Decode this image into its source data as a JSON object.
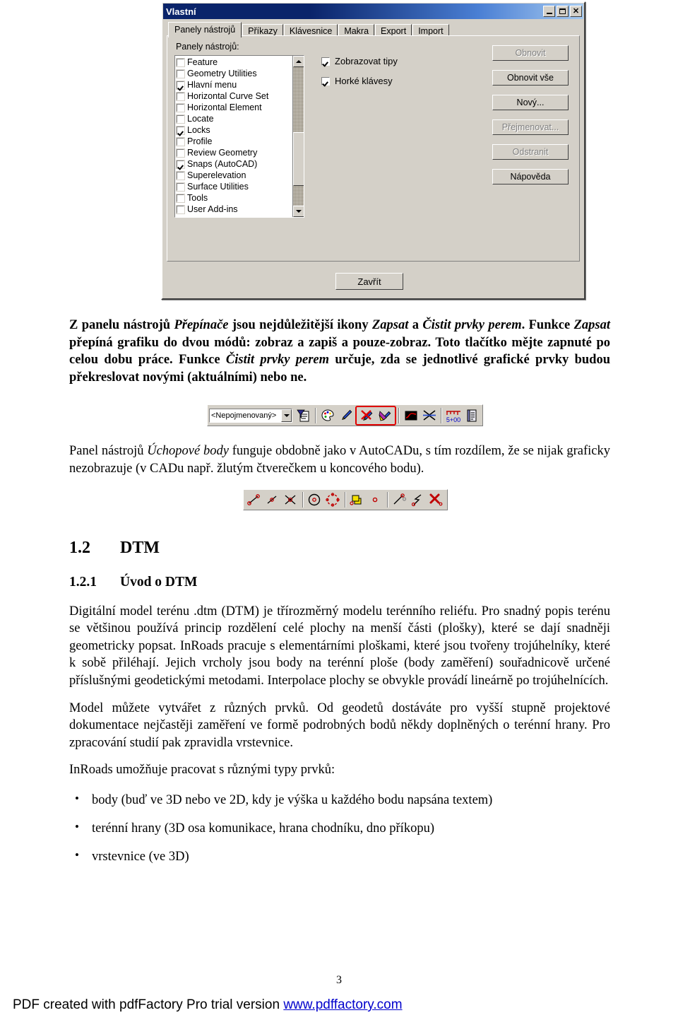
{
  "dialog": {
    "title": "Vlastní",
    "window_buttons": [
      {
        "name": "minimize",
        "glyph": "_"
      },
      {
        "name": "maximize",
        "glyph": "□"
      },
      {
        "name": "close",
        "glyph": "✕"
      }
    ],
    "tabs": [
      {
        "label": "Panely nástrojů",
        "active": true
      },
      {
        "label": "Příkazy",
        "active": false
      },
      {
        "label": "Klávesnice",
        "active": false
      },
      {
        "label": "Makra",
        "active": false
      },
      {
        "label": "Export",
        "active": false
      },
      {
        "label": "Import",
        "active": false
      }
    ],
    "group_label": "Panely nástrojů:",
    "toolbar_list": [
      {
        "label": "Feature",
        "checked": false
      },
      {
        "label": "Geometry Utilities",
        "checked": false
      },
      {
        "label": "Hlavní menu",
        "checked": true
      },
      {
        "label": "Horizontal Curve Set",
        "checked": false
      },
      {
        "label": "Horizontal Element",
        "checked": false
      },
      {
        "label": "Locate",
        "checked": false
      },
      {
        "label": "Locks",
        "checked": true
      },
      {
        "label": "Profile",
        "checked": false
      },
      {
        "label": "Review Geometry",
        "checked": false
      },
      {
        "label": "Snaps (AutoCAD)",
        "checked": true
      },
      {
        "label": "Superelevation",
        "checked": false
      },
      {
        "label": "Surface Utilities",
        "checked": false
      },
      {
        "label": "Tools",
        "checked": false
      },
      {
        "label": "User Add-ins",
        "checked": false
      }
    ],
    "options": [
      {
        "label": "Zobrazovat tipy",
        "checked": true
      },
      {
        "label": "Horké klávesy",
        "checked": true
      }
    ],
    "buttons": [
      {
        "label": "Obnovit",
        "disabled": true
      },
      {
        "label": "Obnovit vše",
        "disabled": false
      },
      {
        "label": "Nový...",
        "disabled": false
      },
      {
        "label": "Přejmenovat...",
        "disabled": true
      },
      {
        "label": "Odstranit",
        "disabled": true
      },
      {
        "label": "Nápověda",
        "disabled": false
      }
    ],
    "close_button": "Zavřít"
  },
  "doc": {
    "p1_a": "Z panelu nástrojů ",
    "p1_i1": "Přepínače",
    "p1_b": " jsou nejdůležitější ikony ",
    "p1_i2": "Zapsat",
    "p1_c": " a ",
    "p1_i3": "Čistit prvky perem",
    "p1_d": ". Funkce ",
    "p1_i4": "Zapsat",
    "p1_e": " přepíná grafiku do dvou módů: zobraz a zapiš a pouze-zobraz. Toto tlačítko mějte zapnuté po celou dobu práce. Funkce ",
    "p1_i5": "Čistit prvky perem",
    "p1_f": " určuje, zda se jednotlivé grafické prvky budou překreslovat novými (aktuálními) nebo ne.",
    "p2_a": "Panel nástrojů ",
    "p2_i1": "Úchopové body",
    "p2_b": " funguje obdobně jako v AutoCADu, s tím rozdílem, že se nijak graficky nezobrazuje (v CADu např. žlutým čtverečkem u koncového bodu).",
    "h2_num": "1.2",
    "h2_text": "DTM",
    "h3_num": "1.2.1",
    "h3_text": "Úvod o DTM",
    "p3": "Digitální model terénu .dtm (DTM) je třírozměrný modelu terénního reliéfu. Pro snadný popis terénu se většinou používá princip rozdělení celé plochy na menší části (plošky), které se dají snadněji geometricky popsat. InRoads pracuje s elementárními ploškami, které jsou tvořeny trojúhelníky, které k sobě přiléhají. Jejich vrcholy jsou body na terénní ploše (body zaměření) souřadnicově určené příslušnými geodetickými metodami. Interpolace plochy se obvykle provádí lineárně po trojúhelnících.",
    "p4": "Model můžete vytvářet z různých prvků. Od geodetů dostáváte pro vyšší stupně projektové dokumentace nejčastěji zaměření ve formě podrobných bodů někdy doplněných o terénní hrany. Pro zpracování studií pak zpravidla vrstevnice.",
    "p5": "InRoads umožňuje pracovat s různými typy prvků:",
    "bullets": [
      "body (buď ve 3D nebo ve 2D, kdy je výška u každého bodu napsána textem)",
      "terénní hrany (3D osa komunikace, hrana chodníku, dno příkopu)",
      "vrstevnice (ve 3D)"
    ]
  },
  "toolbar1": {
    "combo_value": "<Nepojmenovaný>",
    "icons": [
      {
        "name": "named-view-icon"
      },
      {
        "name": "color-palette-icon"
      },
      {
        "name": "pen-icon"
      },
      {
        "name": "clear-pen-icon"
      },
      {
        "name": "write-pen-icon"
      },
      {
        "name": "display-curve-icon"
      },
      {
        "name": "cross-lines-icon"
      },
      {
        "name": "station-ruler-icon"
      },
      {
        "name": "report-icon"
      }
    ],
    "highlight_color": "#e00000",
    "station_label": "5+00"
  },
  "toolbar2": {
    "icons": [
      {
        "name": "snap-endpoint-icon"
      },
      {
        "name": "snap-midpoint-icon"
      },
      {
        "name": "snap-intersection-icon"
      },
      {
        "name": "snap-center-icon"
      },
      {
        "name": "snap-quadrant-icon"
      },
      {
        "name": "snap-insertion-icon"
      },
      {
        "name": "snap-node-icon"
      },
      {
        "name": "snap-perpendicular-icon"
      },
      {
        "name": "snap-tangent-icon"
      },
      {
        "name": "snap-none-icon"
      }
    ]
  },
  "footer": {
    "page_number": "3",
    "text": "PDF created with pdfFactory Pro trial version ",
    "link": "www.pdffactory.com"
  }
}
